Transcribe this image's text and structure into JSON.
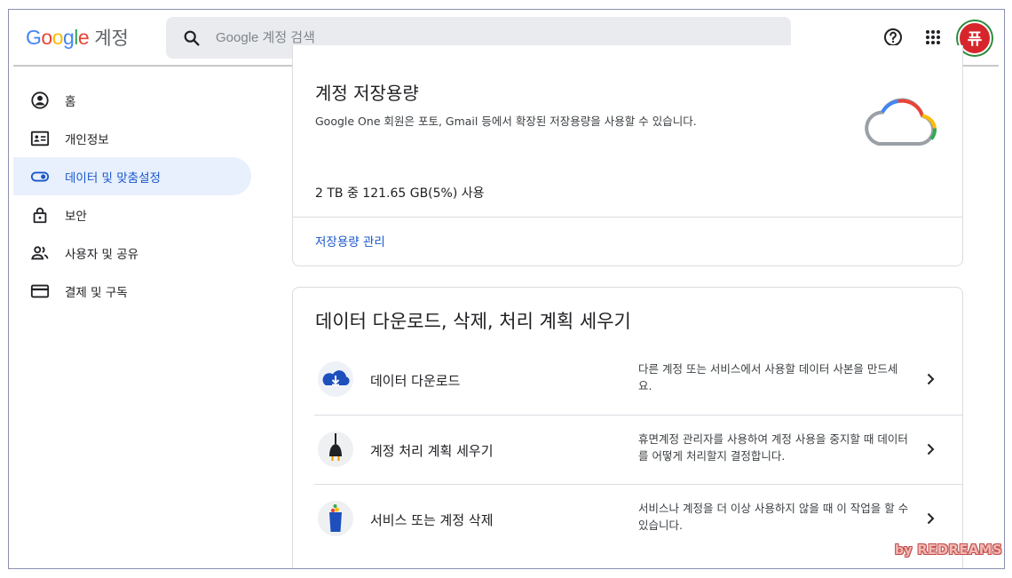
{
  "header": {
    "logo": {
      "letters": [
        "G",
        "o",
        "o",
        "g",
        "l",
        "e"
      ],
      "colors": [
        "#4285F4",
        "#EA4335",
        "#FBBC05",
        "#4285F4",
        "#34A853",
        "#EA4335"
      ]
    },
    "brand_suffix": "계정",
    "search": {
      "placeholder": "Google 계정 검색",
      "value": ""
    },
    "icons": [
      "search-icon",
      "help-icon",
      "apps-grid-icon"
    ],
    "avatar_text": "퓨"
  },
  "sidebar": {
    "items": [
      {
        "label": "홈",
        "icon": "account-circle-icon",
        "active": false
      },
      {
        "label": "개인정보",
        "icon": "id-card-icon",
        "active": false
      },
      {
        "label": "데이터 및 맞춤설정",
        "icon": "toggle-icon",
        "active": true
      },
      {
        "label": "보안",
        "icon": "lock-icon",
        "active": false
      },
      {
        "label": "사용자 및 공유",
        "icon": "people-icon",
        "active": false
      },
      {
        "label": "결제 및 구독",
        "icon": "credit-card-icon",
        "active": false
      }
    ]
  },
  "storage_card": {
    "title": "계정 저장용량",
    "description": "Google One 회원은 포토, Gmail 등에서 확장된 저장용량을 사용할 수 있습니다.",
    "usage": "2 TB 중 121.65 GB(5%) 사용",
    "usage_fraction": 0.05,
    "manage_link": "저장용량 관리"
  },
  "data_card": {
    "title": "데이터 다운로드, 삭제, 처리 계획 세우기",
    "rows": [
      {
        "title": "데이터 다운로드",
        "description": "다른 계정 또는 서비스에서 사용할 데이터 사본을 만드세요.",
        "icon": "cloud-download-icon"
      },
      {
        "title": "계정 처리 계획 세우기",
        "description": "휴면계정 관리자를 사용하여 계정 사용을 중지할 때 데이터를 어떻게 처리할지 결정합니다.",
        "icon": "plug-icon"
      },
      {
        "title": "서비스 또는 계정 삭제",
        "description": "서비스나 계정을 더 이상 사용하지 않을 때 이 작업을 할 수 있습니다.",
        "icon": "trash-bin-icon"
      }
    ]
  },
  "watermark": {
    "by": "by",
    "name": "REDREAMS"
  },
  "colors": {
    "accent": "#1a57c9",
    "active_bg": "#e8f0fe",
    "divider": "#dadce0"
  }
}
